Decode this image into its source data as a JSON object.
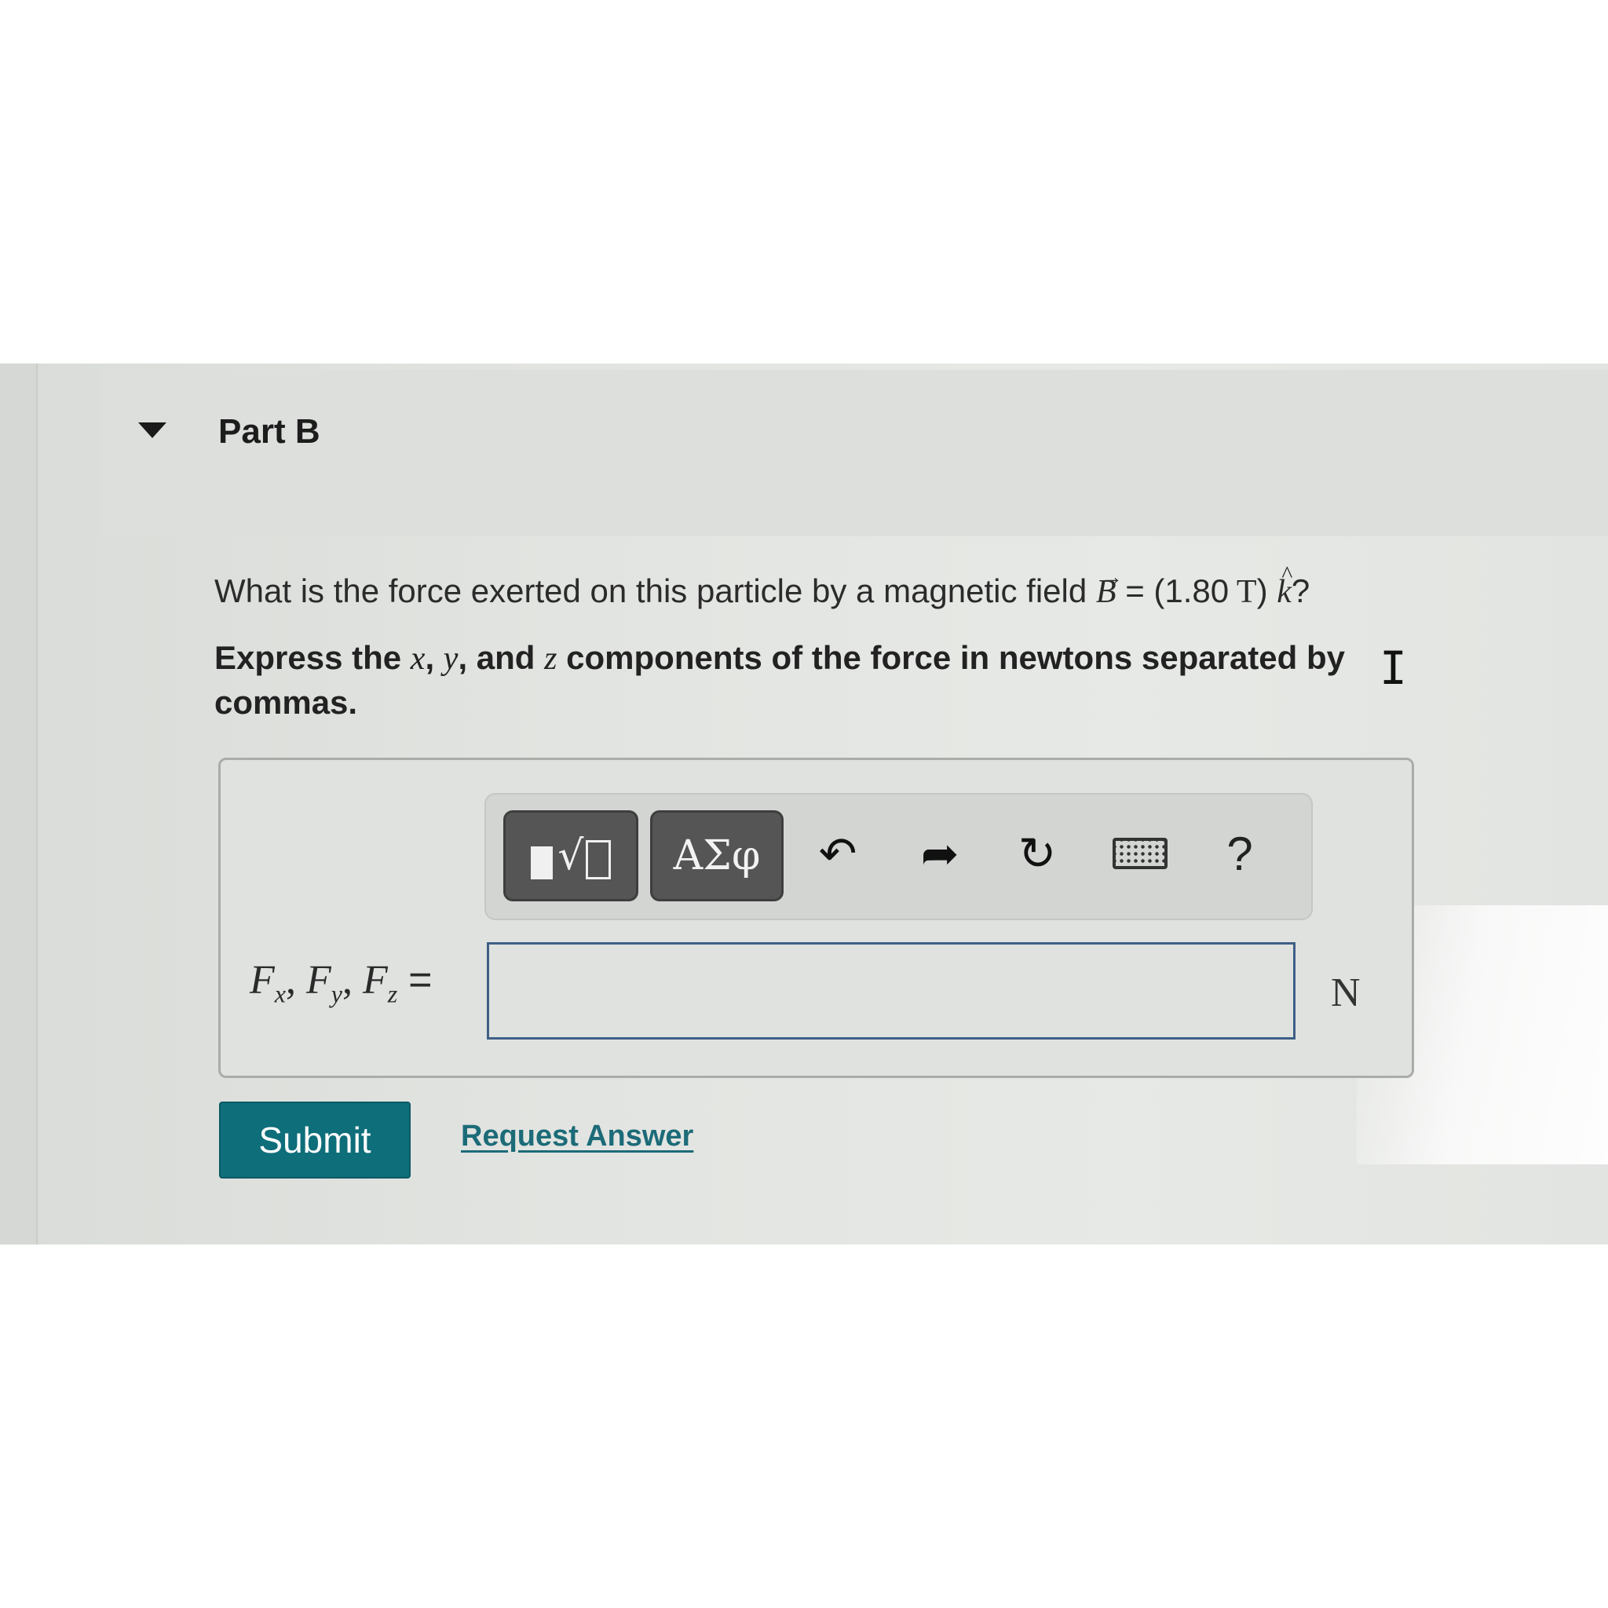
{
  "part": {
    "title": "Part B"
  },
  "question": {
    "prefix": "What is the force exerted on this particle by a magnetic field ",
    "field_symbol": "B",
    "equals": " = (",
    "value": "1.80",
    "unit_t": " T",
    "close": ") ",
    "k_symbol": "k",
    "qmark": "?"
  },
  "instruction": {
    "part1": "Express the ",
    "x": "x",
    "sep1": ", ",
    "y": "y",
    "part2": ", and ",
    "z": "z",
    "part3": " components of the force in newtons separated by commas."
  },
  "toolbar": {
    "templates_icon": "templates-sqrt-icon",
    "greek_label": "ΑΣφ",
    "undo_icon": "undo-icon",
    "redo_icon": "redo-icon",
    "reset_icon": "reset-icon",
    "keyboard_icon": "keyboard-icon",
    "help_label": "?"
  },
  "answer": {
    "label_F": "F",
    "sub_x": "x",
    "sub_y": "y",
    "sub_z": "z",
    "comma": ", ",
    "equals": "=",
    "value": "",
    "unit": "N"
  },
  "actions": {
    "submit_label": "Submit",
    "request_label": "Request Answer"
  },
  "colors": {
    "submit_bg": "#0e6e7a",
    "link": "#1c6b78",
    "toolbar_button": "#555555",
    "input_border": "#3f5f86"
  }
}
